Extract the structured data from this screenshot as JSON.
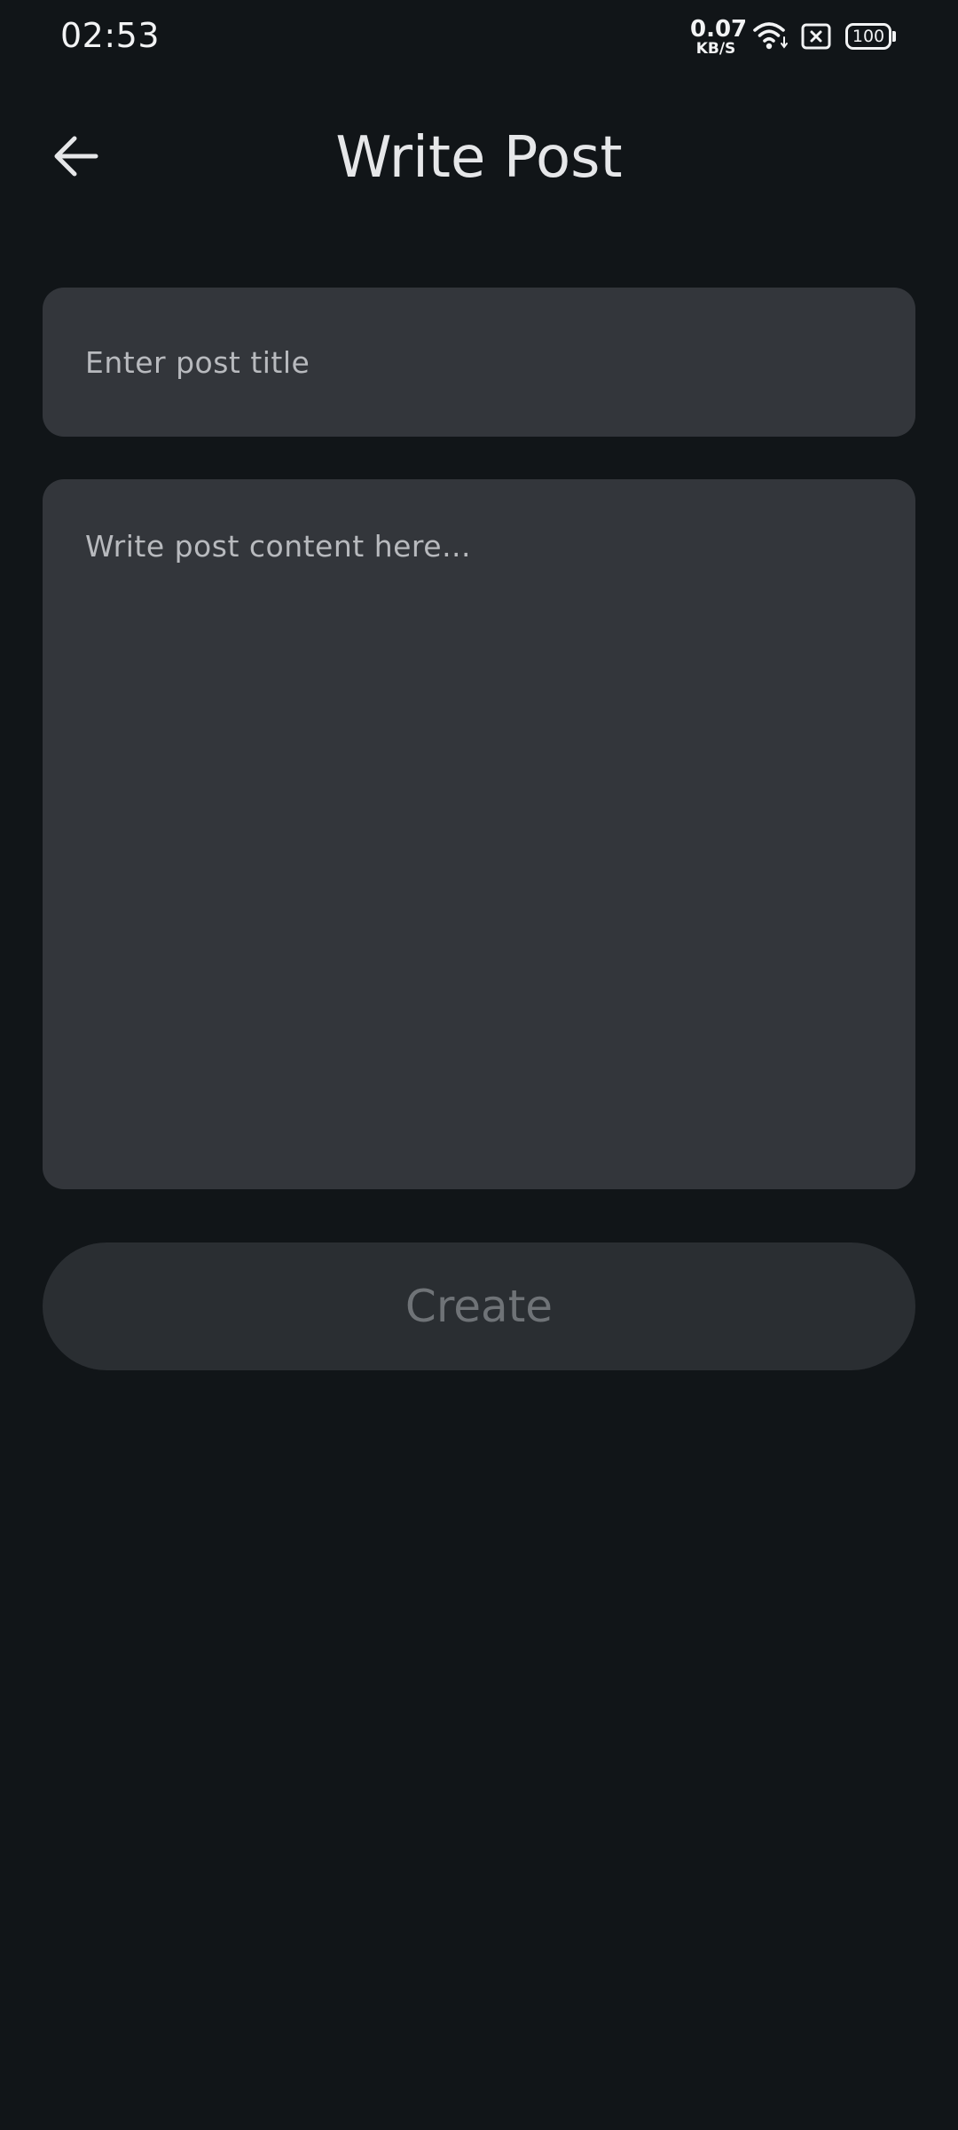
{
  "status_bar": {
    "time": "02:53",
    "net_speed_value": "0.07",
    "net_speed_unit": "KB/S",
    "battery_level": "100",
    "icons": [
      "wifi-icon",
      "sim-disabled-icon",
      "battery-icon"
    ]
  },
  "header": {
    "back_icon": "arrow-left-icon",
    "title": "Write Post"
  },
  "form": {
    "title_input": {
      "value": "",
      "placeholder": "Enter post title"
    },
    "content_input": {
      "value": "",
      "placeholder": "Write post content here..."
    },
    "create_label": "Create"
  },
  "colors": {
    "background": "#111518",
    "field_background": "#33363b",
    "button_background": "#2a2e32",
    "button_text_disabled": "#6f7377",
    "placeholder_text": "#b8babe",
    "title_text": "#e6e7e9"
  }
}
